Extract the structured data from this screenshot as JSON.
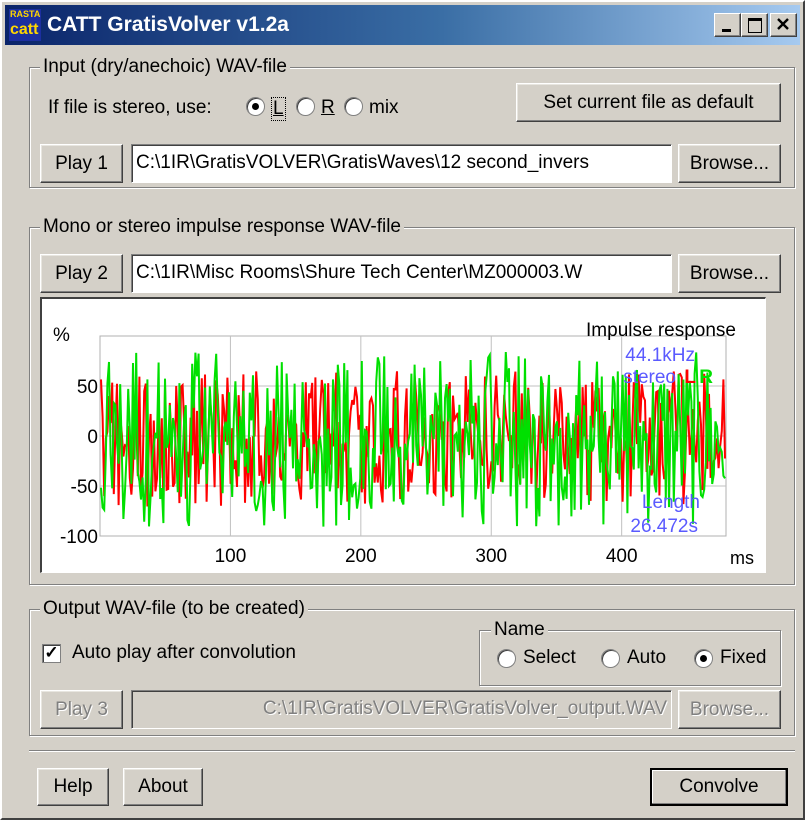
{
  "window": {
    "title": "CATT GratisVolver v1.2a",
    "icon_text_top": "RASTA",
    "icon_text": "catt"
  },
  "input_group": {
    "legend": "Input (dry/anechoic) WAV-file",
    "stereo_label": "If file is stereo, use:",
    "options": [
      "L",
      "R",
      "mix"
    ],
    "selected": "L",
    "set_default_label": "Set current file as default",
    "play_label": "Play 1",
    "file_path": "C:\\1IR\\GratisVOLVER\\GratisWaves\\12 second_invers",
    "browse_label": "Browse..."
  },
  "ir_group": {
    "legend": "Mono or stereo impulse response WAV-file",
    "play_label": "Play 2",
    "file_path": "C:\\1IR\\Misc Rooms\\Shure Tech Center\\MZ000003.W",
    "browse_label": "Browse..."
  },
  "chart_data": {
    "type": "line",
    "title": "Impulse response",
    "ylabel": "%",
    "xlabel": "ms",
    "xlim": [
      0,
      480
    ],
    "ylim": [
      -100,
      100
    ],
    "x_ticks": [
      100,
      200,
      300,
      400
    ],
    "y_ticks": [
      50,
      0,
      -50,
      -100
    ],
    "grid": true,
    "annotations": {
      "sample_rate": "44.1kHz",
      "channels": "stereo",
      "length_label": "Length",
      "length_value": "26.472s",
      "legend_L": "L",
      "legend_R": "R"
    },
    "series": [
      {
        "name": "L",
        "color": "#ff0000",
        "description": "noise-like signal spanning roughly -70 to +65 %"
      },
      {
        "name": "R",
        "color": "#00e000",
        "description": "noise-like signal spanning roughly -100 to +95 %"
      }
    ],
    "colors": {
      "annotation": "#5a5aff",
      "grid": "#c0c0c0"
    }
  },
  "output_group": {
    "legend": "Output WAV-file (to be created)",
    "autoplay_label": "Auto play after convolution",
    "autoplay_checked": true,
    "name_legend": "Name",
    "name_options": [
      "Select",
      "Auto",
      "Fixed"
    ],
    "name_selected": "Fixed",
    "play_label": "Play 3",
    "file_path": "C:\\1IR\\GratisVOLVER\\GratisVolver_output.WAV",
    "browse_label": "Browse..."
  },
  "footer": {
    "help_label": "Help",
    "about_label": "About",
    "convolve_label": "Convolve"
  }
}
